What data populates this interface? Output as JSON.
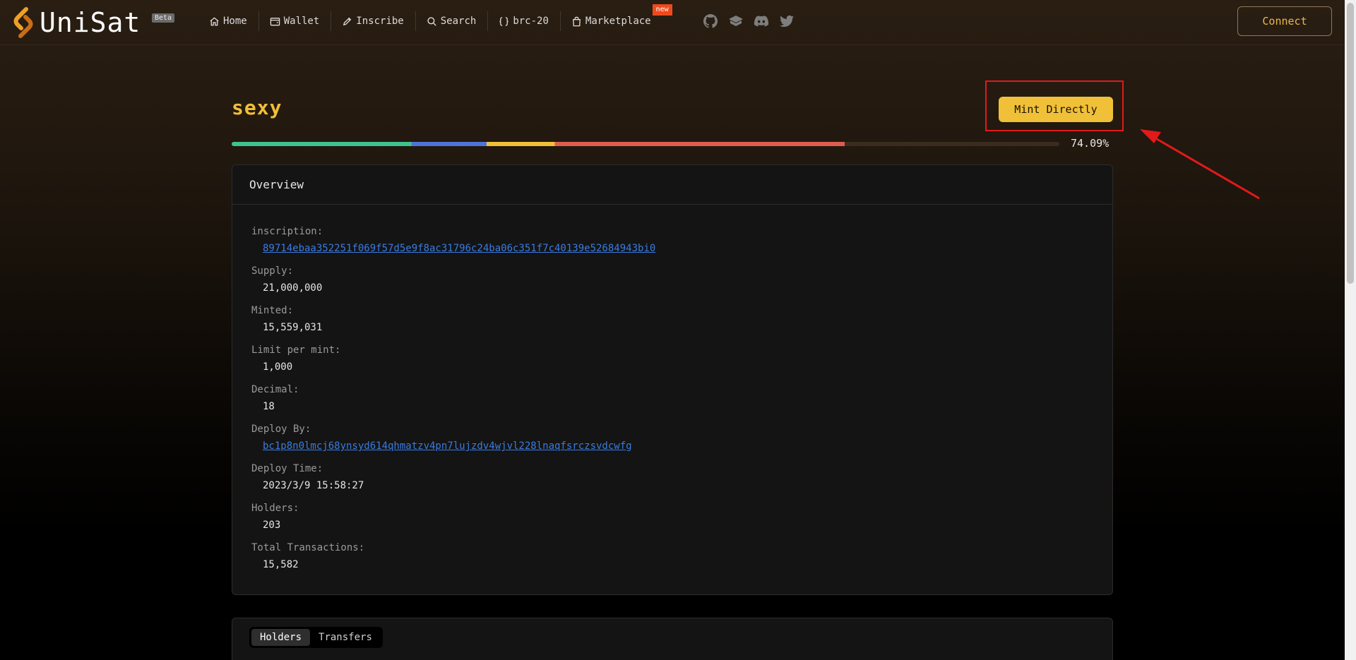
{
  "header": {
    "brand": "UniSat",
    "beta_label": "Beta",
    "nav": [
      {
        "label": "Home",
        "icon": "home-icon"
      },
      {
        "label": "Wallet",
        "icon": "wallet-icon"
      },
      {
        "label": "Inscribe",
        "icon": "pencil-icon"
      },
      {
        "label": "Search",
        "icon": "search-icon"
      },
      {
        "label": "brc-20",
        "icon": "braces-icon"
      },
      {
        "label": "Marketplace",
        "icon": "bag-icon",
        "badge": "new"
      }
    ],
    "socials": [
      "github-icon",
      "gitbook-icon",
      "discord-icon",
      "twitter-icon"
    ],
    "connect_label": "Connect"
  },
  "token": {
    "title": "sexy",
    "mint_label": "Mint Directly",
    "progress_percent": 74.09,
    "progress_label": "74.09%"
  },
  "overview": {
    "title": "Overview",
    "fields": [
      {
        "label": "inscription:",
        "value": "89714ebaa352251f069f57d5e9f8ac31796c24ba06c351f7c40139e52684943bi0",
        "link": true
      },
      {
        "label": "Supply:",
        "value": "21,000,000"
      },
      {
        "label": "Minted:",
        "value": "15,559,031"
      },
      {
        "label": "Limit per mint:",
        "value": "1,000"
      },
      {
        "label": "Decimal:",
        "value": "18"
      },
      {
        "label": "Deploy By:",
        "value": "bc1p8n0lmcj68ynsyd614qhmatzv4pn7lujzdv4wjvl228lnaqfsrczsvdcwfg",
        "link": true
      },
      {
        "label": "Deploy Time:",
        "value": "2023/3/9 15:58:27"
      },
      {
        "label": "Holders:",
        "value": "203"
      },
      {
        "label": "Total Transactions:",
        "value": "15,582"
      }
    ]
  },
  "tabs": [
    {
      "label": "Holders",
      "active": true
    },
    {
      "label": "Transfers",
      "active": false
    }
  ],
  "colors": {
    "accent": "#f0c038",
    "highlight_box": "#e21a1a",
    "link": "#3a7be0"
  }
}
